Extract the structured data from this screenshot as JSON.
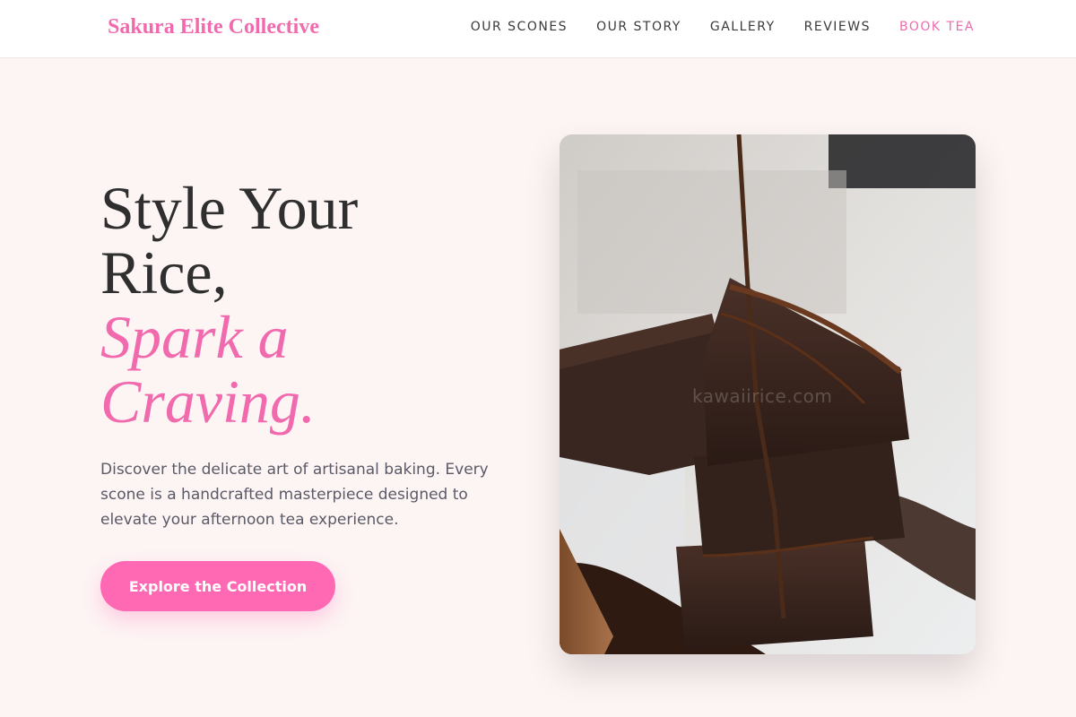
{
  "brand": {
    "name": "Sakura Elite Collective"
  },
  "nav": {
    "items": [
      {
        "label": "OUR SCONES"
      },
      {
        "label": "OUR STORY"
      },
      {
        "label": "GALLERY"
      },
      {
        "label": "REVIEWS"
      },
      {
        "label": "BOOK TEA"
      }
    ]
  },
  "hero": {
    "headline_line1": "Style Your",
    "headline_line2": "Rice,",
    "headline_accent_line1": "Spark a",
    "headline_accent_line2": "Craving.",
    "description": "Discover the delicate art of artisanal baking. Every scone is a handcrafted masterpiece designed to elevate your afternoon tea experience.",
    "cta_label": "Explore the Collection",
    "image_watermark": "kawaiirice.com"
  },
  "colors": {
    "accent": "#f26aae",
    "button": "#ff69b4",
    "background": "#fdf4f4",
    "text_dark": "#2f2f2f",
    "text_muted": "#5a5a66"
  }
}
